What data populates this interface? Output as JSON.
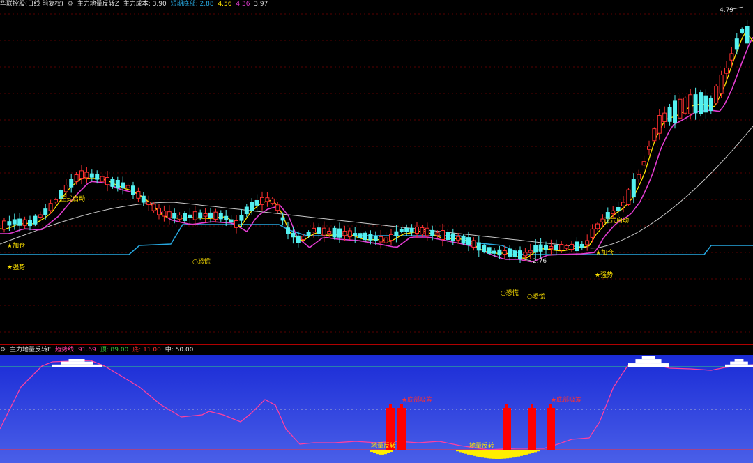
{
  "main_header": {
    "stock": "华联控股(日线 前复权)",
    "indicator": "主力地量反转Z",
    "cost_label": "主力成本:",
    "cost_value": "3.90",
    "bottom_label": "短期底部:",
    "bottom_value": "2.88",
    "v2": "4.56",
    "v3": "4.36",
    "v4": "3.97",
    "icon": "gear-icon"
  },
  "sub_header": {
    "title": "主力地量反转F",
    "trend_label": "趋势线:",
    "trend_value": "91.69",
    "top_label": "顶:",
    "top_value": "89.00",
    "bottom_label": "底:",
    "bottom_value": "11.00",
    "mid_label": "中:",
    "mid_value": "50.00",
    "icon": "gear-icon"
  },
  "colors": {
    "up": "#ff3030",
    "down": "#54f0f0",
    "ma_fast": "#ffe300",
    "ma_mid": "#e23cd0",
    "ma_slow": "#c8c8c8",
    "support": "#27a8e0",
    "sub_trend": "#ff40a0"
  },
  "annotations": {
    "high_price": "4.79",
    "low_price": "2.76",
    "start_1": "正式启动",
    "start_2": "正式启动",
    "add_1": "★加仓",
    "add_2": "★加仓",
    "strong_1": "★强势",
    "strong_2": "★强势",
    "panic_1": "○恐慌",
    "panic_2": "○恐慌",
    "panic_3": "○恐慌",
    "sub_reverse_1": "地量反转",
    "sub_reverse_2": "地量反转",
    "sub_star_1": "★底部吸筹",
    "sub_star_2": "★底部吸筹"
  }
}
